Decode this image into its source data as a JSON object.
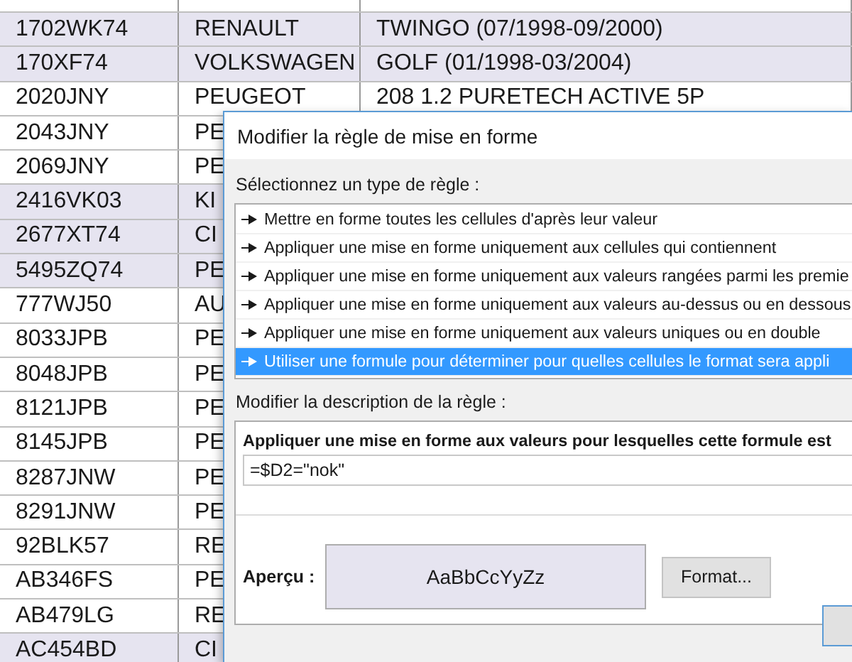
{
  "sheet": {
    "rows": [
      {
        "cells": [
          "1702WK74",
          "RENAULT",
          "TWINGO (07/1998-09/2000)"
        ],
        "highlighted": true
      },
      {
        "cells": [
          "170XF74",
          "VOLKSWAGEN",
          "GOLF (01/1998-03/2004)"
        ],
        "highlighted": true
      },
      {
        "cells": [
          "2020JNY",
          "PEUGEOT",
          "208 1.2 PURETECH ACTIVE 5P"
        ],
        "highlighted": false
      },
      {
        "cells": [
          "2043JNY",
          "PE"
        ],
        "highlighted": false
      },
      {
        "cells": [
          "2069JNY",
          "PE"
        ],
        "highlighted": false
      },
      {
        "cells": [
          "2416VK03",
          "KI"
        ],
        "highlighted": true
      },
      {
        "cells": [
          "2677XT74",
          "CI"
        ],
        "highlighted": true
      },
      {
        "cells": [
          "5495ZQ74",
          "PE"
        ],
        "highlighted": true
      },
      {
        "cells": [
          "777WJ50",
          "AU"
        ],
        "highlighted": false
      },
      {
        "cells": [
          "8033JPB",
          "PE"
        ],
        "highlighted": false
      },
      {
        "cells": [
          "8048JPB",
          "PE"
        ],
        "highlighted": false
      },
      {
        "cells": [
          "8121JPB",
          "PE"
        ],
        "highlighted": false
      },
      {
        "cells": [
          "8145JPB",
          "PE"
        ],
        "highlighted": false
      },
      {
        "cells": [
          "8287JNW",
          "PE"
        ],
        "highlighted": false
      },
      {
        "cells": [
          "8291JNW",
          "PE"
        ],
        "highlighted": false
      },
      {
        "cells": [
          "92BLK57",
          "RE"
        ],
        "highlighted": false
      },
      {
        "cells": [
          "AB346FS",
          "PE"
        ],
        "highlighted": false
      },
      {
        "cells": [
          "AB479LG",
          "RE"
        ],
        "highlighted": false
      },
      {
        "cells": [
          "AC454BD",
          "CI"
        ],
        "highlighted": true
      }
    ]
  },
  "dialog": {
    "title": "Modifier la règle de mise en forme",
    "rule_type_label": "Sélectionnez un type de règle :",
    "rule_types": [
      {
        "label": "Mettre en forme toutes les cellules d'après leur valeur",
        "selected": false
      },
      {
        "label": "Appliquer une mise en forme uniquement aux cellules qui contiennent",
        "selected": false
      },
      {
        "label": "Appliquer une mise en forme uniquement aux valeurs rangées parmi les premie",
        "selected": false
      },
      {
        "label": "Appliquer une mise en forme uniquement aux valeurs au-dessus ou en dessous",
        "selected": false
      },
      {
        "label": "Appliquer une mise en forme uniquement aux valeurs uniques ou en double",
        "selected": false
      },
      {
        "label": "Utiliser une formule pour déterminer pour quelles cellules le format sera appli",
        "selected": true
      }
    ],
    "description_label": "Modifier la description de la règle :",
    "formula_heading": "Appliquer une mise en forme aux valeurs pour lesquelles cette formule est",
    "formula": "=$D2=\"nok\"",
    "preview_label": "Aperçu :",
    "preview_sample": "AaBbCcYyZz",
    "format_button": "Format..."
  }
}
